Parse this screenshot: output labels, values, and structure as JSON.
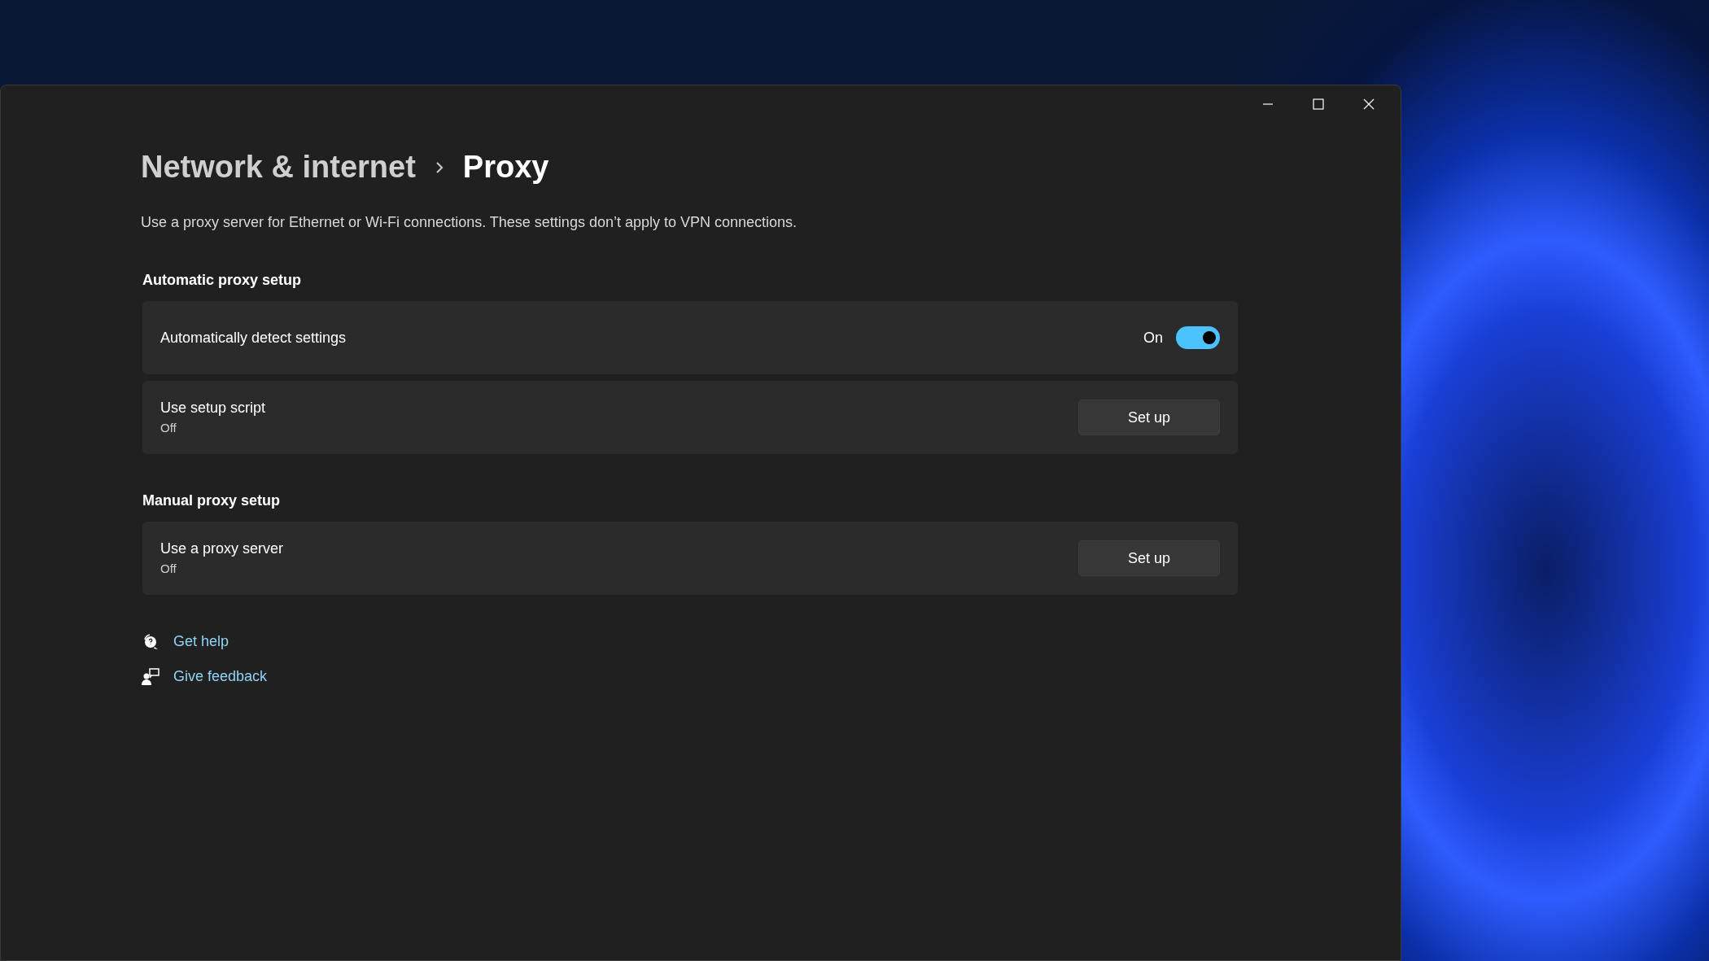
{
  "breadcrumb": [
    {
      "label": "Network & internet",
      "selected": false
    },
    {
      "label": "Proxy",
      "selected": true
    }
  ],
  "description": "Use a proxy server for Ethernet or Wi-Fi connections. These settings don’t apply to VPN connections.",
  "sections": [
    {
      "title": "Automatic proxy setup",
      "items": [
        {
          "kind": "toggle",
          "label": "Automatically detect settings",
          "state_text": "On",
          "on": true
        },
        {
          "kind": "button",
          "label": "Use setup script",
          "status": "Off",
          "button": "Set up"
        }
      ]
    },
    {
      "title": "Manual proxy setup",
      "items": [
        {
          "kind": "button",
          "label": "Use a proxy server",
          "status": "Off",
          "button": "Set up"
        }
      ]
    }
  ],
  "links": [
    {
      "kind": "help",
      "label": "Get help"
    },
    {
      "kind": "feedback",
      "label": "Give feedback"
    }
  ]
}
